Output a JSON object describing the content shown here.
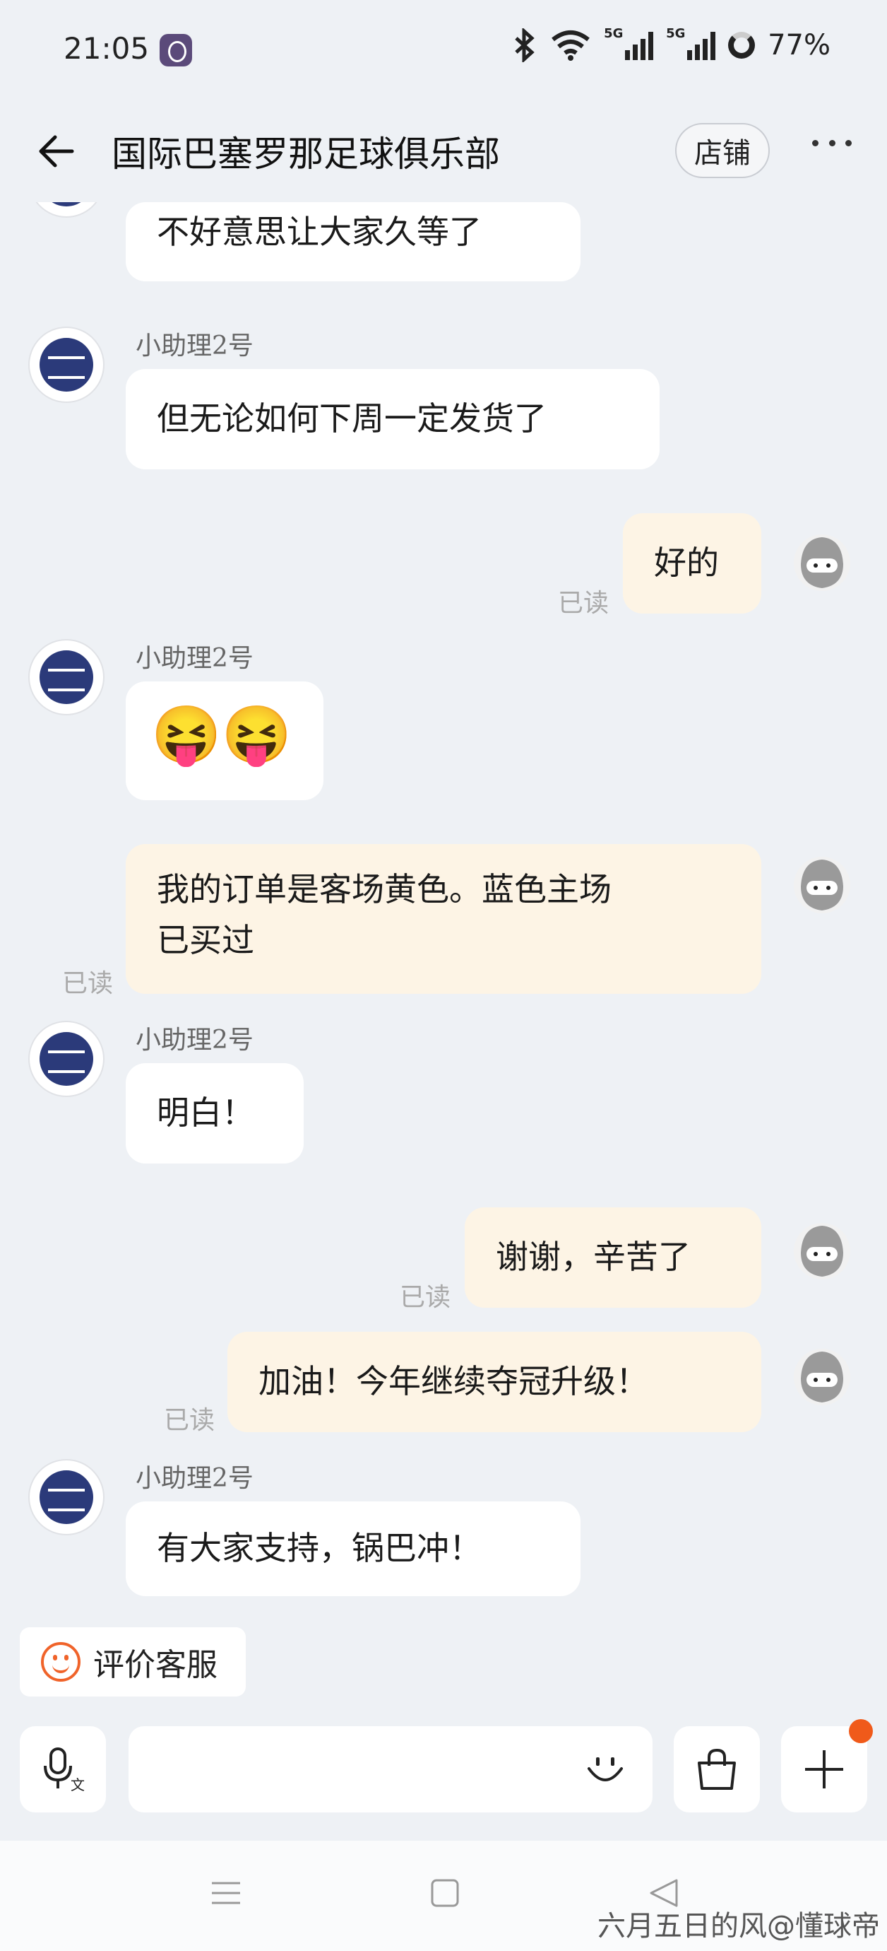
{
  "status": {
    "time": "21:05",
    "battery": "77%",
    "network1": "5G",
    "network2": "5G"
  },
  "header": {
    "title": "国际巴塞罗那足球俱乐部",
    "shop_label": "店铺"
  },
  "messages": [
    {
      "side": "in",
      "text": "不好意思让大家久等了"
    },
    {
      "side": "in",
      "sender": "小助理2号",
      "text": "但无论如何下周一定发货了"
    },
    {
      "side": "out",
      "text": "好的",
      "status": "已读"
    },
    {
      "side": "in",
      "sender": "小助理2号",
      "text": "😝😝"
    },
    {
      "side": "out",
      "text_line1": "我的订单是客场黄色。蓝色主场",
      "text_line2": "已买过",
      "status": "已读"
    },
    {
      "side": "in",
      "sender": "小助理2号",
      "text": "明白！"
    },
    {
      "side": "out",
      "text": "谢谢，辛苦了",
      "status": "已读"
    },
    {
      "side": "out",
      "text": "加油！今年继续夺冠升级！",
      "status": "已读"
    },
    {
      "side": "in",
      "sender": "小助理2号",
      "text": "有大家支持，锅巴冲！"
    }
  ],
  "rate_button": {
    "label": "评价客服"
  },
  "watermark": "六月五日的风@懂球帝",
  "colors": {
    "accent": "#f05a1a",
    "out_bubble": "#fdf4e5",
    "in_bubble": "#ffffff",
    "background": "#eef1f5"
  }
}
